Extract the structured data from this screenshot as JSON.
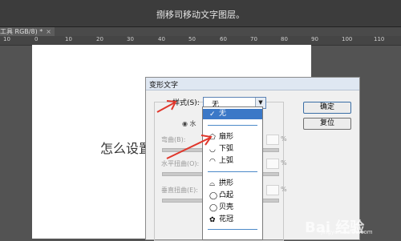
{
  "app": {
    "title": "捌移司移动文字图层。"
  },
  "tab": {
    "label": "工具 RGB/8) *",
    "close": "×"
  },
  "ruler": {
    "ticks": [
      "10",
      "0",
      "10",
      "20",
      "30",
      "40",
      "50",
      "60",
      "70",
      "80",
      "90",
      "100",
      "110"
    ]
  },
  "canvas": {
    "text": "怎么设置"
  },
  "dialog": {
    "title": "变形文字",
    "style_label": "样式(S):",
    "style_value": "无",
    "orientation": "◉ 水",
    "bend_label": "弯曲(B):",
    "hdist_label": "水平扭曲(O):",
    "vdist_label": "垂直扭曲(E):",
    "pct": "%",
    "ok": "确定",
    "reset": "复位"
  },
  "dropdown": {
    "items": [
      {
        "label": "无",
        "icon": "✓"
      },
      {
        "label": "扇形",
        "icon": "⬠"
      },
      {
        "label": "下弧",
        "icon": "◡"
      },
      {
        "label": "上弧",
        "icon": "◠"
      },
      {
        "label": "拱形",
        "icon": "⌓"
      },
      {
        "label": "凸起",
        "icon": "◯"
      },
      {
        "label": "贝壳",
        "icon": "◯"
      },
      {
        "label": "花冠",
        "icon": "✿"
      }
    ]
  },
  "watermark": {
    "brand": "Bai 经验",
    "url": "jingyan.baidu.com"
  }
}
